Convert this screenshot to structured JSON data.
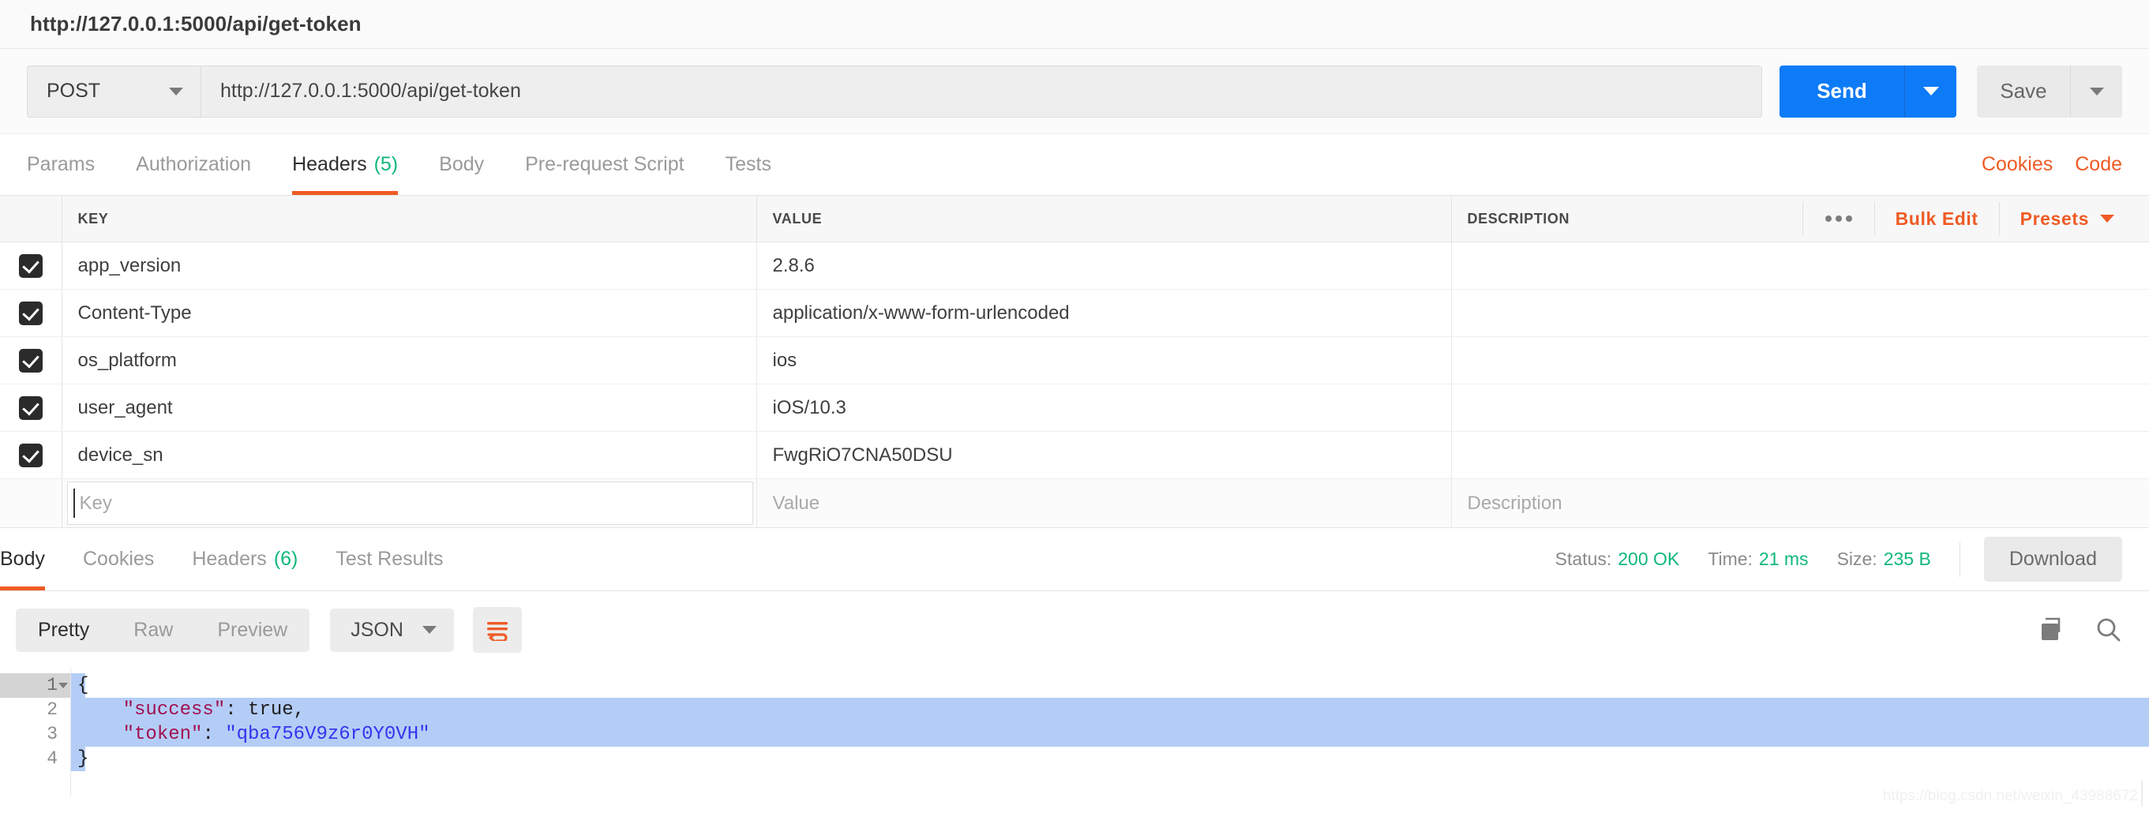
{
  "window": {
    "title": "http://127.0.0.1:5000/api/get-token"
  },
  "request_bar": {
    "method": "POST",
    "url": "http://127.0.0.1:5000/api/get-token",
    "send_label": "Send",
    "save_label": "Save"
  },
  "request_tabs": {
    "items": [
      {
        "label": "Params",
        "count": ""
      },
      {
        "label": "Authorization",
        "count": ""
      },
      {
        "label": "Headers",
        "count": "(5)"
      },
      {
        "label": "Body",
        "count": ""
      },
      {
        "label": "Pre-request Script",
        "count": ""
      },
      {
        "label": "Tests",
        "count": ""
      }
    ],
    "active": "Headers",
    "right_links": [
      {
        "label": "Cookies"
      },
      {
        "label": "Code"
      }
    ]
  },
  "headers_table": {
    "columns": [
      "KEY",
      "VALUE",
      "DESCRIPTION"
    ],
    "actions": {
      "more_label": "•••",
      "bulk_edit_label": "Bulk Edit",
      "presets_label": "Presets"
    },
    "rows": [
      {
        "checked": true,
        "key": "app_version",
        "value": "2.8.6",
        "description": ""
      },
      {
        "checked": true,
        "key": "Content-Type",
        "value": "application/x-www-form-urlencoded",
        "description": ""
      },
      {
        "checked": true,
        "key": "os_platform",
        "value": "ios",
        "description": ""
      },
      {
        "checked": true,
        "key": "user_agent",
        "value": "iOS/10.3",
        "description": ""
      },
      {
        "checked": true,
        "key": "device_sn",
        "value": "FwgRiO7CNA50DSU",
        "description": ""
      }
    ],
    "new_row": {
      "key_placeholder": "Key",
      "value_placeholder": "Value",
      "description_placeholder": "Description"
    }
  },
  "response_tabs": {
    "items": [
      {
        "label": "Body",
        "count": ""
      },
      {
        "label": "Cookies",
        "count": ""
      },
      {
        "label": "Headers",
        "count": "(6)"
      },
      {
        "label": "Test Results",
        "count": ""
      }
    ],
    "active": "Body"
  },
  "response_status": {
    "status_label": "Status:",
    "status_value": "200 OK",
    "time_label": "Time:",
    "time_value": "21 ms",
    "size_label": "Size:",
    "size_value": "235 B",
    "download_label": "Download"
  },
  "body_toolbar": {
    "modes": [
      {
        "label": "Pretty"
      },
      {
        "label": "Raw"
      },
      {
        "label": "Preview"
      }
    ],
    "active_mode": "Pretty",
    "format": "JSON",
    "wrap_icon": "word-wrap-icon",
    "copy_icon": "copy-icon",
    "search_icon": "search-icon"
  },
  "response_body": {
    "line_numbers": [
      "1",
      "2",
      "3",
      "4"
    ],
    "lines": [
      {
        "indent": 0,
        "parts": [
          {
            "t": "{",
            "c": "punct"
          }
        ]
      },
      {
        "indent": 1,
        "parts": [
          {
            "t": "\"success\"",
            "c": "key"
          },
          {
            "t": ": ",
            "c": "punct"
          },
          {
            "t": "true",
            "c": "bool"
          },
          {
            "t": ",",
            "c": "punct"
          }
        ]
      },
      {
        "indent": 1,
        "parts": [
          {
            "t": "\"token\"",
            "c": "key"
          },
          {
            "t": ": ",
            "c": "punct"
          },
          {
            "t": "\"qba756V9z6r0Y0VH\"",
            "c": "str"
          }
        ]
      },
      {
        "indent": 0,
        "parts": [
          {
            "t": "}",
            "c": "punct"
          }
        ]
      }
    ],
    "raw": "{\n    \"success\": true,\n    \"token\": \"qba756V9z6r0Y0VH\"\n}"
  },
  "watermark": {
    "text": "https://blog.csdn.net/weixin_43988672"
  },
  "colors": {
    "accent_orange": "#ef5b25",
    "send_blue": "#0d7bf7",
    "status_green": "#10b87a",
    "json_key": "#a11050",
    "json_string": "#3333ee",
    "selection": "#b4cdf6"
  }
}
